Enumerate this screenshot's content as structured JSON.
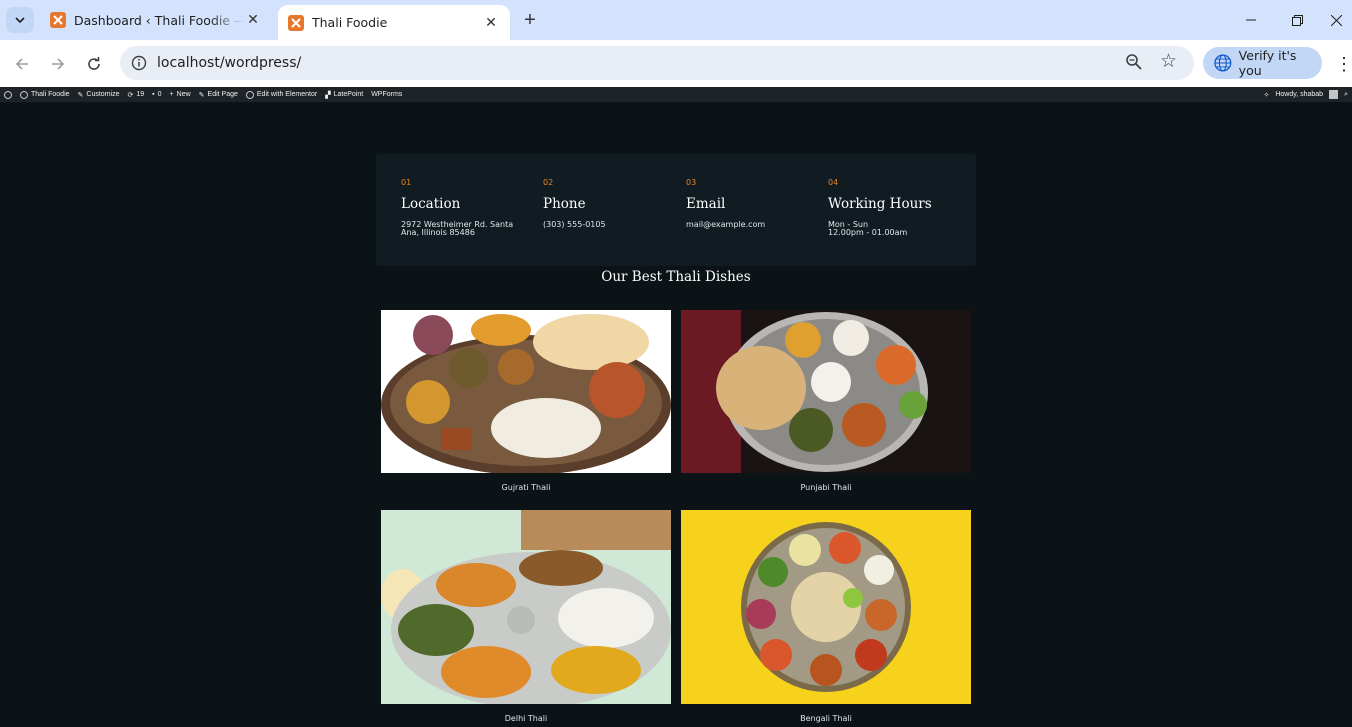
{
  "browser": {
    "tabs": [
      {
        "title": "Dashboard ‹ Thali Foodie — WordPress",
        "active": false
      },
      {
        "title": "Thali Foodie",
        "active": true
      }
    ],
    "url": "localhost/wordpress/",
    "verify_label": "Verify it's you"
  },
  "adminbar": {
    "items": [
      "Thali Foodie",
      "Customize",
      "19",
      "0",
      "New",
      "Edit Page",
      "Edit with Elementor",
      "LatePoint",
      "WPForms"
    ],
    "greeting": "Howdy, shabab"
  },
  "contact": [
    {
      "num": "01",
      "heading": "Location",
      "detail": [
        "2972 Westheimer Rd. Santa",
        "Ana, Illinois 85486"
      ]
    },
    {
      "num": "02",
      "heading": "Phone",
      "detail": [
        "(303) 555-0105"
      ]
    },
    {
      "num": "03",
      "heading": "Email",
      "detail": [
        "mail@example.com"
      ]
    },
    {
      "num": "04",
      "heading": "Working Hours",
      "detail": [
        "Mon - Sun",
        "12.00pm - 01.00am"
      ]
    }
  ],
  "section_title": "Our Best Thali Dishes",
  "dishes": [
    {
      "name": "Gujrati Thali",
      "bg": "#ffffff"
    },
    {
      "name": "Punjabi Thali",
      "bg": "#1a1313"
    },
    {
      "name": "Delhi Thali",
      "bg": "#cfe9d6"
    },
    {
      "name": "Bengali Thali",
      "bg": "#f7d21c"
    }
  ]
}
